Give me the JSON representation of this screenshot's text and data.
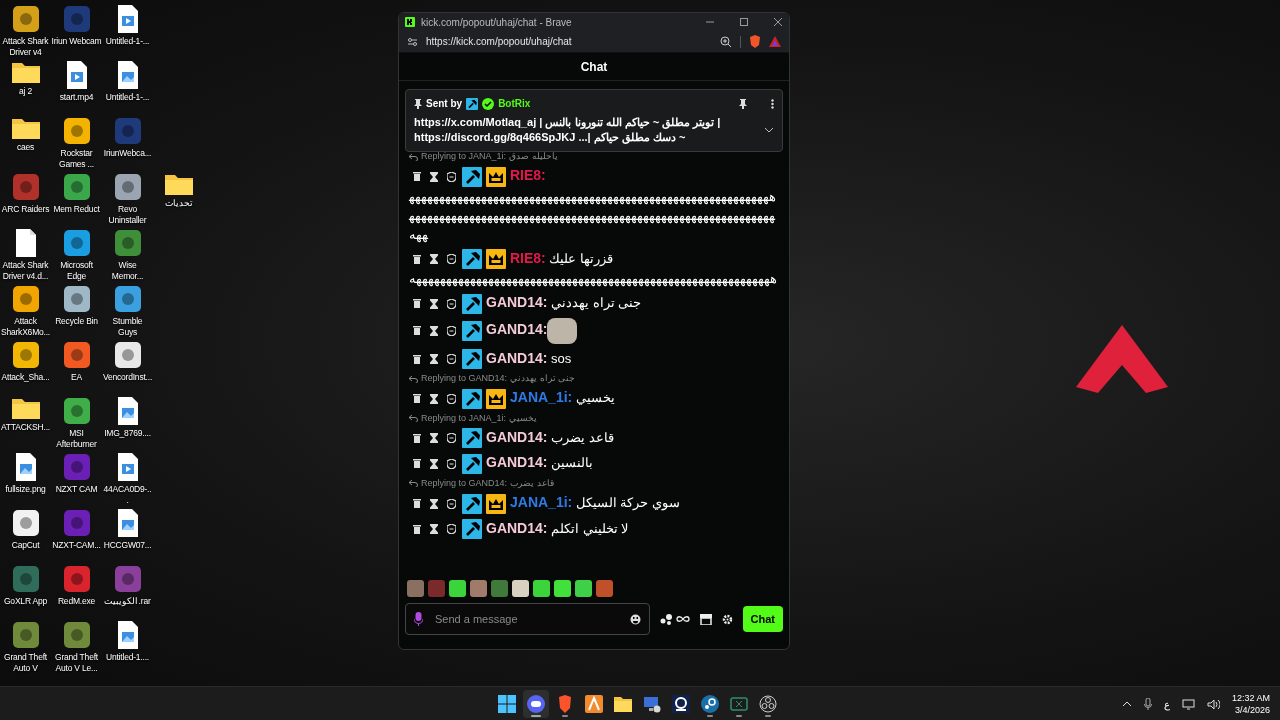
{
  "desktop": {
    "columns": [
      [
        {
          "label": "Attack Shark Driver v4",
          "kind": "app",
          "color": "#d4a017"
        },
        {
          "label": "aj 2",
          "kind": "folder"
        },
        {
          "label": "caes",
          "kind": "folder"
        },
        {
          "label": "ARC Raiders",
          "kind": "app",
          "color": "#b0302a"
        },
        {
          "label": "Attack Shark Driver v4.d...",
          "kind": "doc"
        },
        {
          "label": "Attack SharkX6Mo...",
          "kind": "app",
          "color": "#f0a500"
        },
        {
          "label": "Attack_Sha...",
          "kind": "app",
          "color": "#f2b705"
        },
        {
          "label": "ATTACKSH...",
          "kind": "folder"
        },
        {
          "label": "fullsize.png",
          "kind": "image"
        },
        {
          "label": "CapCut",
          "kind": "app",
          "color": "#f2f2f2"
        },
        {
          "label": "GoXLR App",
          "kind": "app",
          "color": "#2f6d5a"
        },
        {
          "label": "Grand Theft Auto V",
          "kind": "app",
          "color": "#6e8a3a"
        }
      ],
      [
        {
          "label": "Iriun Webcam",
          "kind": "app",
          "color": "#1f3a7a"
        },
        {
          "label": "start.mp4",
          "kind": "video"
        },
        {
          "label": "Rockstar Games ...",
          "kind": "app",
          "color": "#f5b301"
        },
        {
          "label": "Mem Reduct",
          "kind": "app",
          "color": "#3aa84a"
        },
        {
          "label": "Microsoft Edge",
          "kind": "app",
          "color": "#1b9de2"
        },
        {
          "label": "Recycle Bin",
          "kind": "app",
          "color": "#9fb8c8"
        },
        {
          "label": "EA",
          "kind": "app",
          "color": "#f05a22"
        },
        {
          "label": "MSI Afterburner",
          "kind": "app",
          "color": "#3fae49"
        },
        {
          "label": "NZXT CAM",
          "kind": "app",
          "color": "#6a1fb5"
        },
        {
          "label": "NZXT-CAM...",
          "kind": "app",
          "color": "#6a1fb5"
        },
        {
          "label": "RedM.exe",
          "kind": "app",
          "color": "#d9232d"
        },
        {
          "label": "Grand Theft Auto V Le...",
          "kind": "app",
          "color": "#6e8a3a"
        }
      ],
      [
        {
          "label": "Untitled-1-...",
          "kind": "video"
        },
        {
          "label": "Untitled-1-...",
          "kind": "image"
        },
        {
          "label": "IriunWebca...",
          "kind": "app",
          "color": "#1f3a7a"
        },
        {
          "label": "Revo Uninstaller",
          "kind": "app",
          "color": "#9aa5b1"
        },
        {
          "label": "Wise Memor...",
          "kind": "app",
          "color": "#3f8f3a"
        },
        {
          "label": "Stumble Guys",
          "kind": "app",
          "color": "#3aa0e0"
        },
        {
          "label": "VencordInst...",
          "kind": "app",
          "color": "#e8e8e8"
        },
        {
          "label": "IMG_8769....",
          "kind": "image"
        },
        {
          "label": "44ACA0D9-...",
          "kind": "video"
        },
        {
          "label": "HCCGW07...",
          "kind": "image"
        },
        {
          "label": "الكويبيت.rar",
          "kind": "app",
          "color": "#8a3f9a"
        },
        {
          "label": "Untitled-1....",
          "kind": "image"
        }
      ],
      [
        {
          "label": "تحديات",
          "kind": "folder"
        }
      ]
    ]
  },
  "browser": {
    "title": "kick.com/popout/uhaj/chat - Brave",
    "url": "https://kick.com/popout/uhaj/chat"
  },
  "chat": {
    "header": "Chat",
    "pinned": {
      "sent_by": "Sent by",
      "user": "BotRix",
      "lines": [
        {
          "link": "https://x.com/Motlaq_aj",
          "text": "| تويتر مطلق ~ حياكم الله تنورونا بالنس |"
        },
        {
          "link": "https://discord.gg/8q466SpJKJ",
          "text": "~ دسك مطلق حياكم |..."
        }
      ]
    },
    "messages": [
      {
        "reply": {
          "label": "Replying to JANA_1i:",
          "quote": "ياحليله صدق"
        },
        "user": "RIE8:",
        "color": "#e2184a",
        "mod": true,
        "vip": true,
        "kind": "wrapped",
        "text": "ههههههههههههههههههههههههههههههههههههههههههههههههههههههههههههههههههههههههههههههههههههههههههههههههههههههههههههههههههههههههههههه"
      },
      {
        "user": "RIE8:",
        "color": "#e2184a",
        "mod": true,
        "vip": true,
        "kind": "text",
        "text": "قزرتها عليك",
        "more": "ههههههههههههههههههههههههههههههههههههههههههههههههههههههههههههه"
      },
      {
        "user": "GAND14:",
        "color": "#f6cbd9",
        "mod": true,
        "vip": false,
        "kind": "text",
        "text": "جنى تراه يهددني"
      },
      {
        "user": "GAND14:",
        "color": "#f6cbd9",
        "mod": true,
        "vip": false,
        "kind": "emote"
      },
      {
        "user": "GAND14:",
        "color": "#f6cbd9",
        "mod": true,
        "vip": false,
        "kind": "text",
        "text": "sos"
      },
      {
        "reply": {
          "label": "Replying to GAND14:",
          "quote": "جنى تراه يهددني"
        },
        "user": "JANA_1i:",
        "color": "#2f7be6",
        "mod": true,
        "vip": true,
        "kind": "text",
        "text": "يخسيي"
      },
      {
        "reply": {
          "label": "Replying to JANA_1i:",
          "quote": "يخسيي"
        },
        "user": "GAND14:",
        "color": "#f6cbd9",
        "mod": true,
        "vip": false,
        "kind": "text",
        "text": "قاعد يضرب"
      },
      {
        "user": "GAND14:",
        "color": "#f6cbd9",
        "mod": true,
        "vip": false,
        "kind": "text",
        "text": "بالنسين"
      },
      {
        "reply": {
          "label": "Replying to GAND14:",
          "quote": "قاعد يضرب"
        },
        "user": "JANA_1i:",
        "color": "#2f7be6",
        "mod": true,
        "vip": true,
        "kind": "text",
        "text": "سوي حركة السيكل"
      },
      {
        "user": "GAND14:",
        "color": "#f6cbd9",
        "mod": true,
        "vip": false,
        "kind": "text",
        "text": "لا تخليني اتكلم"
      }
    ],
    "emotes": [
      {
        "color": "#8a7060"
      },
      {
        "color": "#7a2a2a"
      },
      {
        "color": "#3bd43b"
      },
      {
        "color": "#a07a6a"
      },
      {
        "color": "#3f7a3a"
      },
      {
        "color": "#d8d0c0"
      },
      {
        "color": "#3bd43b"
      },
      {
        "color": "#42e03a"
      },
      {
        "color": "#3fcf48"
      },
      {
        "color": "#c0502a"
      }
    ],
    "input": {
      "placeholder": "Send a message"
    },
    "send": "Chat"
  },
  "taskbar": {
    "apps": [
      {
        "kind": "start",
        "running": false,
        "selected": false
      },
      {
        "kind": "discord",
        "running": true,
        "selected": true
      },
      {
        "kind": "brave",
        "running": true,
        "selected": false
      },
      {
        "kind": "orange-app",
        "running": false,
        "selected": false
      },
      {
        "kind": "folder",
        "running": false,
        "selected": false
      },
      {
        "kind": "monitor",
        "running": false,
        "selected": false
      },
      {
        "kind": "webcam",
        "running": false,
        "selected": false
      },
      {
        "kind": "steam",
        "running": true,
        "selected": false
      },
      {
        "kind": "goxlr",
        "running": true,
        "selected": false
      },
      {
        "kind": "obs",
        "running": true,
        "selected": false
      }
    ],
    "language": "ع",
    "time": "12:32 AM",
    "date": "3/4/2026"
  }
}
